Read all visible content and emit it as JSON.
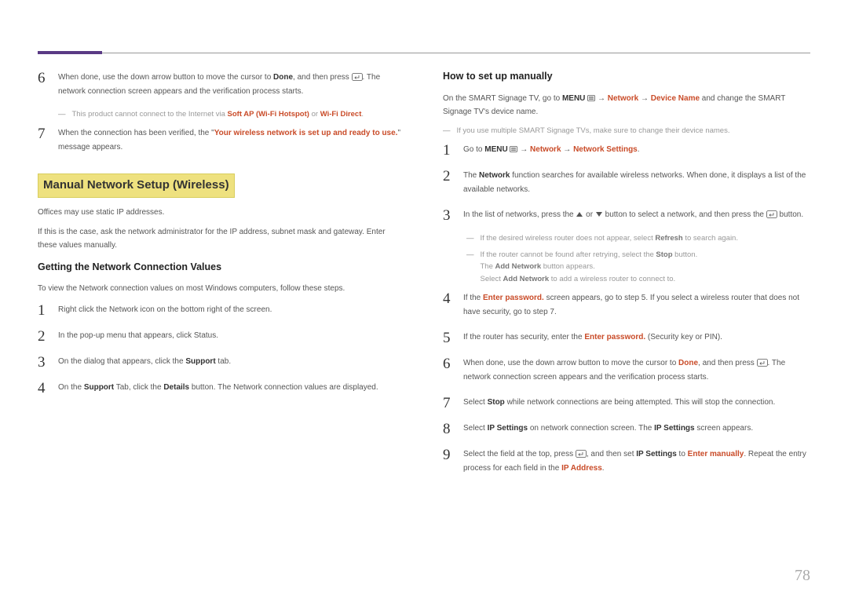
{
  "page_number": "78",
  "left": {
    "s6": {
      "a": "When done, use the down arrow button to move the cursor to ",
      "done": "Done",
      "b": ", and then press ",
      "c": ". The ",
      "d": "network connection screen appears and the verification process starts."
    },
    "note1a": "This product cannot connect to the Internet via ",
    "note1b": "Soft AP (Wi-Fi Hotspot)",
    "note1c": " or ",
    "note1d": "Wi-Fi Direct",
    "s7a": "When the connection has been verified, the \"",
    "s7b": "Your wireless network is set up and ready to use.",
    "s7c": "\" message appears.",
    "h2": "Manual Network Setup (Wireless)",
    "p1": "Offices may use static IP addresses.",
    "p2": "If this is the case, ask the network administrator for the IP address, subnet mask and gateway. Enter these values manually.",
    "sub1": "Getting the Network Connection Values",
    "p3": "To view the Network connection values on most Windows computers, follow these steps.",
    "g1": "Right click the Network icon on the bottom right of the screen.",
    "g2": "In the pop-up menu that appears, click Status.",
    "g3a": "On the dialog that appears, click the ",
    "g3b": "Support",
    "g3c": " tab.",
    "g4a": "On the ",
    "g4b": "Support",
    "g4c": " Tab, click the ",
    "g4d": "Details",
    "g4e": " button. The Network connection values are displayed."
  },
  "right": {
    "sub": "How to set up manually",
    "intro_a": "On the SMART Signage TV, go to ",
    "intro_b": "MENU",
    "intro_c": " → ",
    "intro_d": "Network",
    "intro_e": " → ",
    "intro_f": "Device Name",
    "intro_g": " and change the SMART Signage TV's device name.",
    "note_intro": "If you use multiple SMART Signage TVs, make sure to change their device names.",
    "s1a": "Go to ",
    "s1b": "MENU",
    "s1c": " → ",
    "s1d": "Network",
    "s1e": " → ",
    "s1f": "Network Settings",
    "s2a": "The ",
    "s2b": "Network",
    "s2c": " function searches for available wireless networks. When done, it displays a list of the available networks.",
    "s3a": "In the list of networks, press the ",
    "s3b": " or ",
    "s3c": " button to select a network, and then press the ",
    "s3d": " button.",
    "n3a": "If the desired wireless router does not appear, select ",
    "n3a_b": "Refresh",
    "n3a_c": " to search again.",
    "n3b": "If the router cannot be found after retrying, select the ",
    "n3b_b": "Stop",
    "n3b_c": " button.",
    "n3c_a": "The ",
    "n3c_b": "Add Network",
    "n3c_c": " button appears.",
    "n3d_a": "Select ",
    "n3d_b": "Add Network",
    "n3d_c": " to add a wireless router to connect to.",
    "s4a": "If the ",
    "s4b": "Enter password.",
    "s4c": " screen appears, go to step 5. If you select a wireless router that does not have security, go to step 7.",
    "s5a": "If the router has security, enter the ",
    "s5b": "Enter password.",
    "s5c": " (Security key or PIN).",
    "s6a": "When done, use the down arrow button to move the cursor to ",
    "s6b": "Done",
    "s6c": ", and then press ",
    "s6d": ". The network connection screen appears and the verification process starts.",
    "s7a": "Select ",
    "s7b": "Stop",
    "s7c": " while network connections are being attempted. This will stop the connection.",
    "s8a": "Select ",
    "s8b": "IP Settings",
    "s8c": " on network connection screen. The ",
    "s8d": "IP Settings",
    "s8e": " screen appears.",
    "s9a": "Select the field at the top, press ",
    "s9b": ", and then set ",
    "s9c": "IP Settings",
    "s9d": " to ",
    "s9e": "Enter manually",
    "s9f": ". Repeat the entry process for each field in the ",
    "s9g": "IP Address"
  }
}
